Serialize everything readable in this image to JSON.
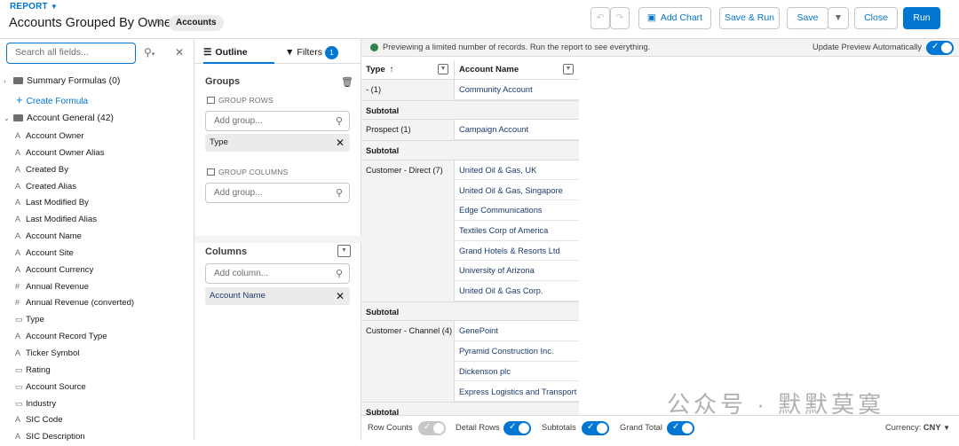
{
  "header": {
    "report_label": "REPORT",
    "title": "Accounts Grouped By Owner",
    "object_badge": "Accounts",
    "buttons": {
      "add_chart": "Add Chart",
      "save_run": "Save & Run",
      "save": "Save",
      "close": "Close",
      "run": "Run"
    }
  },
  "left_panel": {
    "search_placeholder": "Search all fields...",
    "folders": {
      "summary": "Summary Formulas (0)",
      "create_formula": "Create Formula",
      "account_general": "Account General (42)"
    },
    "fields": [
      {
        "type": "A",
        "label": "Account Owner"
      },
      {
        "type": "A",
        "label": "Account Owner Alias"
      },
      {
        "type": "A",
        "label": "Created By"
      },
      {
        "type": "A",
        "label": "Created Alias"
      },
      {
        "type": "A",
        "label": "Last Modified By"
      },
      {
        "type": "A",
        "label": "Last Modified Alias"
      },
      {
        "type": "A",
        "label": "Account Name"
      },
      {
        "type": "A",
        "label": "Account Site"
      },
      {
        "type": "A",
        "label": "Account Currency"
      },
      {
        "type": "#",
        "label": "Annual Revenue"
      },
      {
        "type": "#",
        "label": "Annual Revenue (converted)"
      },
      {
        "type": "▭",
        "label": "Type"
      },
      {
        "type": "A",
        "label": "Account Record Type"
      },
      {
        "type": "A",
        "label": "Ticker Symbol"
      },
      {
        "type": "▭",
        "label": "Rating"
      },
      {
        "type": "▭",
        "label": "Account Source"
      },
      {
        "type": "▭",
        "label": "Industry"
      },
      {
        "type": "A",
        "label": "SIC Code"
      },
      {
        "type": "A",
        "label": "SIC Description"
      }
    ]
  },
  "outline": {
    "tab_outline": "Outline",
    "tab_filters": "Filters",
    "filter_count": "1",
    "groups_title": "Groups",
    "group_rows_label": "GROUP ROWS",
    "add_group_placeholder": "Add group...",
    "group_row_pill": "Type",
    "group_columns_label": "GROUP COLUMNS",
    "add_group_col_placeholder": "Add group...",
    "columns_title": "Columns",
    "add_column_placeholder": "Add column...",
    "column_pill": "Account Name"
  },
  "preview": {
    "notice": "Previewing a limited number of records. Run the report to see everything.",
    "update_label": "Update Preview Automatically",
    "col_type": "Type",
    "col_account": "Account Name",
    "subtotal_label": "Subtotal",
    "groups": [
      {
        "name": "- (1)",
        "accounts": [
          "Community Account"
        ]
      },
      {
        "name": "Prospect (1)",
        "accounts": [
          "Campaign Account"
        ]
      },
      {
        "name": "Customer - Direct (7)",
        "accounts": [
          "United Oil & Gas, UK",
          "United Oil & Gas, Singapore",
          "Edge Communications",
          "Textiles Corp of America",
          "Grand Hotels & Resorts Ltd",
          "University of Arizona",
          "United Oil & Gas Corp."
        ]
      },
      {
        "name": "Customer - Channel (4)",
        "accounts": [
          "GenePoint",
          "Pyramid Construction Inc.",
          "Dickenson plc",
          "Express Logistics and Transport"
        ]
      }
    ]
  },
  "footer": {
    "row_counts": "Row Counts",
    "detail_rows": "Detail Rows",
    "subtotals": "Subtotals",
    "grand_total": "Grand Total",
    "currency_label": "Currency:",
    "currency_value": "CNY"
  },
  "watermark": "公众号 · 默默莫寞",
  "colors": {
    "brand": "#0176d3",
    "success": "#2e844a"
  }
}
